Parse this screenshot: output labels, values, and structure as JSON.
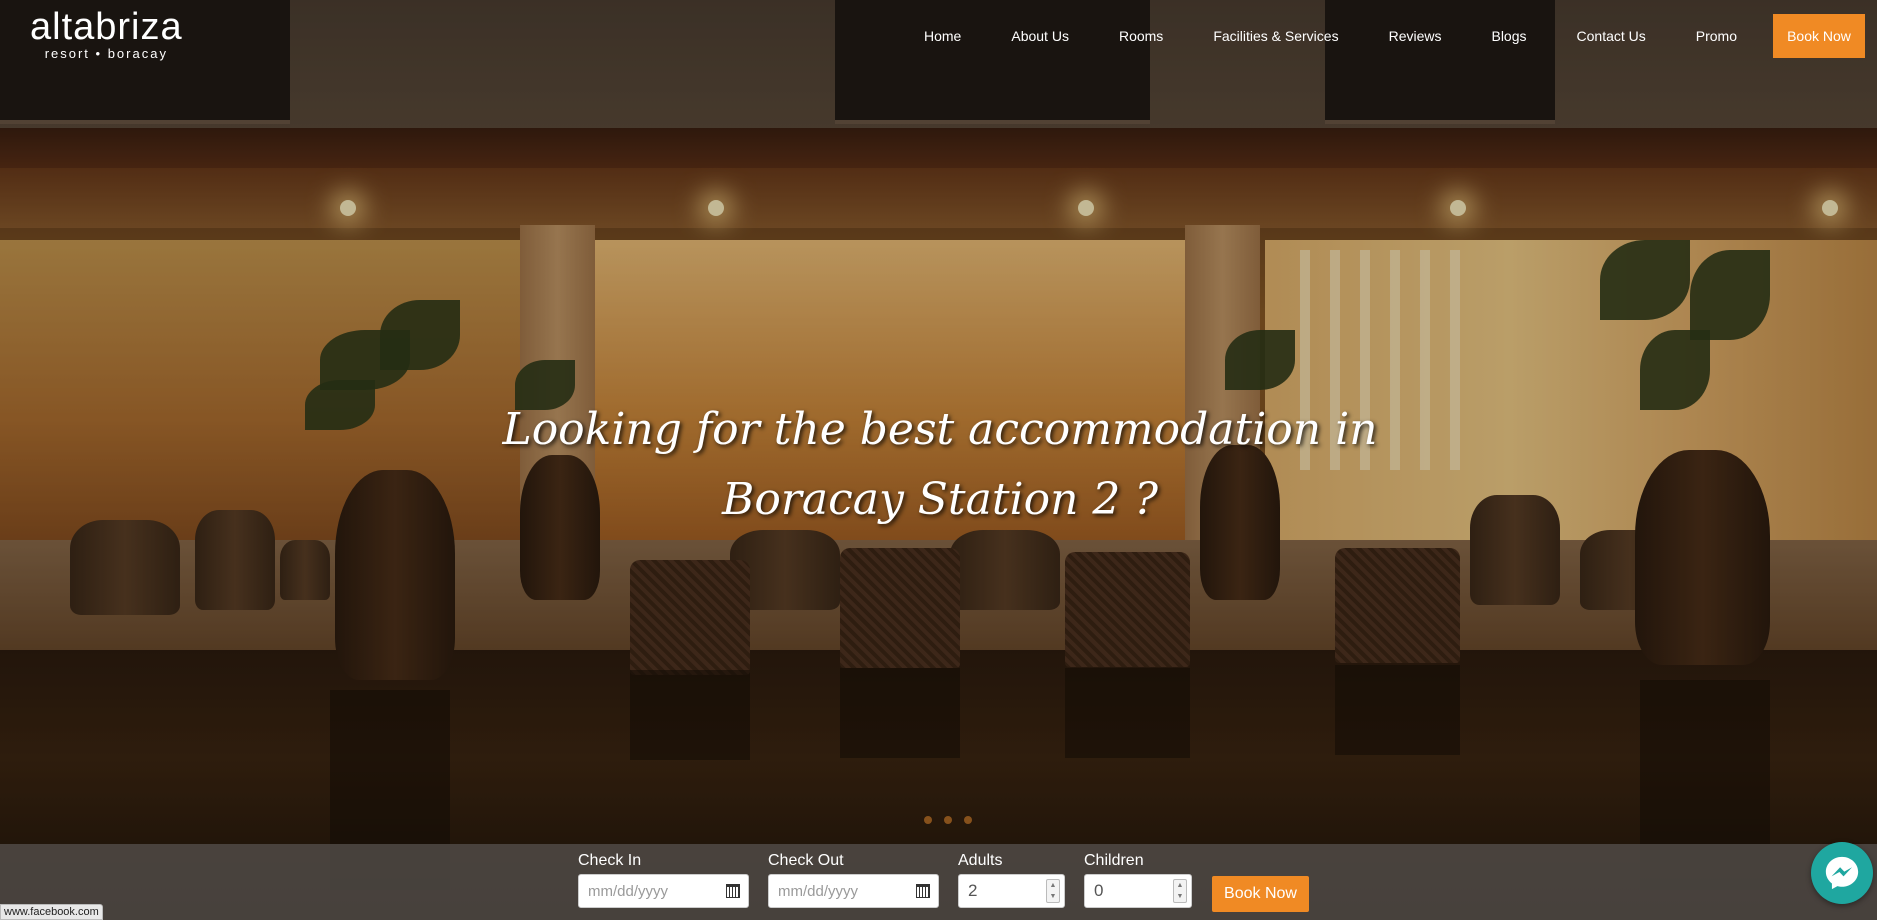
{
  "brand": {
    "name": "altabriza",
    "tagline": "resort • boracay"
  },
  "nav": {
    "items": [
      "Home",
      "About Us",
      "Rooms",
      "Facilities & Services",
      "Reviews",
      "Blogs",
      "Contact Us",
      "Promo"
    ],
    "cta_label": "Book Now"
  },
  "hero": {
    "headline_line1": "Looking for the best accommodation in",
    "headline_line2": "Boracay Station 2 ?",
    "slider_dots": 3
  },
  "booking": {
    "check_in_label": "Check In",
    "check_in_placeholder": "mm/dd/yyyy",
    "check_out_label": "Check Out",
    "check_out_placeholder": "mm/dd/yyyy",
    "adults_label": "Adults",
    "adults_value": "2",
    "children_label": "Children",
    "children_value": "0",
    "submit_label": "Book Now"
  },
  "status_bar": {
    "url": "www.facebook.com"
  },
  "colors": {
    "accent": "#f08a24",
    "messenger": "#1fa7a0"
  },
  "icons": {
    "calendar": "calendar-icon",
    "spinner": "number-spinner-icon",
    "messenger": "messenger-icon"
  }
}
